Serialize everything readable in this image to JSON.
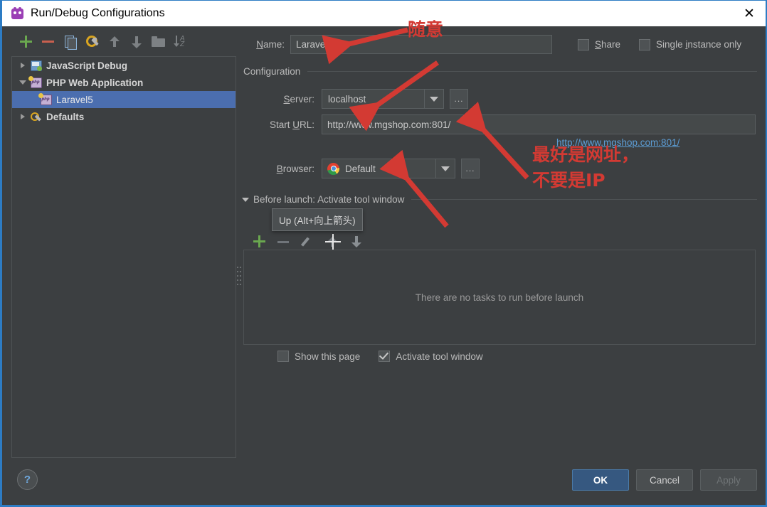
{
  "window": {
    "title": "Run/Debug Configurations",
    "icon": "bug-icon",
    "close_label": "✕"
  },
  "tree_toolbar": {
    "items": [
      {
        "name": "add-configuration-button",
        "icon": "plus-icon",
        "enabled": true
      },
      {
        "name": "remove-configuration-button",
        "icon": "minus-icon",
        "enabled": true
      },
      {
        "name": "copy-configuration-button",
        "icon": "copy-icon",
        "enabled": true
      },
      {
        "name": "edit-templates-button",
        "icon": "gear-wrench-icon",
        "enabled": true
      },
      {
        "name": "move-up-button",
        "icon": "arrow-up-icon",
        "enabled": false
      },
      {
        "name": "move-down-button",
        "icon": "arrow-down-icon",
        "enabled": false
      },
      {
        "name": "create-folder-button",
        "icon": "folder-icon",
        "enabled": false
      },
      {
        "name": "sort-configurations-button",
        "icon": "sort-icon",
        "enabled": false
      }
    ]
  },
  "tree": {
    "nodes": [
      {
        "label": "JavaScript Debug",
        "icon": "javascript-debug-icon",
        "expanded": false,
        "selected": false,
        "child": false,
        "bold": true
      },
      {
        "label": "PHP Web Application",
        "icon": "php-web-icon",
        "expanded": true,
        "selected": false,
        "child": false,
        "bold": true
      },
      {
        "label": "Laravel5",
        "icon": "php-web-icon",
        "expanded": null,
        "selected": true,
        "child": true,
        "bold": false
      },
      {
        "label": "Defaults",
        "icon": "defaults-icon",
        "expanded": false,
        "selected": false,
        "child": false,
        "bold": true
      }
    ]
  },
  "config": {
    "name_label": "Name:",
    "name_label_mnemonic": "N",
    "name_value": "Laravel5",
    "share": {
      "label": "Share",
      "mnemonic": "S",
      "checked": false
    },
    "single_instance": {
      "label": "Single instance only",
      "mnemonic": "i",
      "checked": false
    },
    "section_title": "Configuration",
    "server": {
      "label": "Server:",
      "mnemonic": "S",
      "value": "localhost",
      "browse_label": "..."
    },
    "start_url": {
      "label": "Start URL:",
      "mnemonic": "U",
      "value": "http://www.mgshop.com:801/",
      "link": "http://www.mgshop.com:801/"
    },
    "browser": {
      "label": "Browser:",
      "mnemonic": "B",
      "value": "Default",
      "icon": "chrome-icon",
      "browse_label": "..."
    }
  },
  "before_launch": {
    "header": "Before launch: Activate tool window",
    "header_prefix": "Bef",
    "header_suffix": "ool window",
    "tooltip": "Up (Alt+向上箭头)",
    "toolbar": [
      {
        "name": "add-task-button",
        "icon": "plus-icon",
        "enabled": true
      },
      {
        "name": "remove-task-button",
        "icon": "minus-icon",
        "enabled": false
      },
      {
        "name": "edit-task-button",
        "icon": "pencil-icon",
        "enabled": false
      },
      {
        "name": "move-task-up-button",
        "icon": "arrow-up-icon",
        "enabled": false
      },
      {
        "name": "move-task-down-button",
        "icon": "arrow-down-icon",
        "enabled": false
      }
    ],
    "empty_text": "There are no tasks to run before launch",
    "show_this_page": {
      "label": "Show this page",
      "checked": false
    },
    "activate_tool_window": {
      "label": "Activate tool window",
      "checked": true
    }
  },
  "footer": {
    "help_label": "?",
    "ok": "OK",
    "cancel": "Cancel",
    "apply": "Apply",
    "apply_enabled": false
  },
  "annotations": {
    "accent_color": "#d33a33",
    "note_name": "随意",
    "note_url_line1": "最好是网址，",
    "note_url_line2": "不要是IP"
  }
}
